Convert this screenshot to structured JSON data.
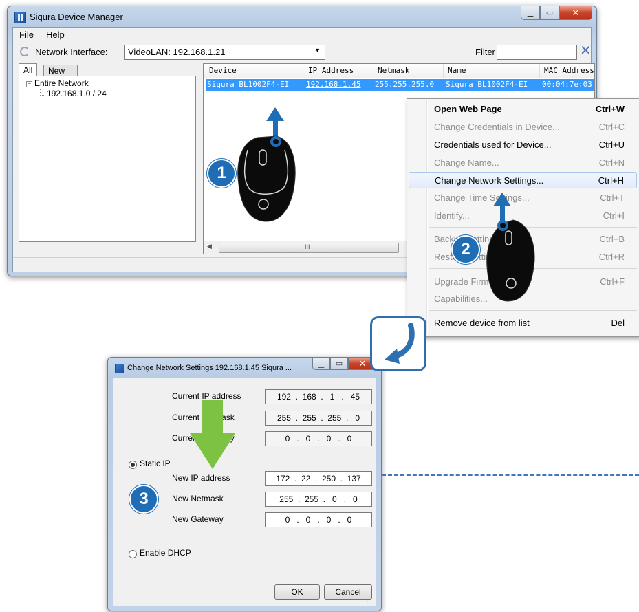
{
  "window": {
    "title": "Siqura Device Manager",
    "menu": [
      "File",
      "Help"
    ],
    "network_interface_label": "Network Interface:",
    "network_interface_value": "VideoLAN: 192.168.1.21",
    "filter_label": "Filter",
    "filter_value": "",
    "tabs": [
      "All",
      "New"
    ],
    "tree_root": "Entire Network",
    "tree_child": "192.168.1.0 / 24",
    "columns": [
      "Device",
      "IP Address",
      "Netmask",
      "Name",
      "MAC Address"
    ],
    "row": {
      "device": "Siqura BL1002F4-EI",
      "ip": "192.168.1.45",
      "netmask": "255.255.255.0",
      "name": "Siqura BL1002F4-EI",
      "mac": "00:04:7e:03"
    },
    "scroll_grip": "III"
  },
  "context_menu": [
    {
      "label": "Open Web Page",
      "shortcut": "Ctrl+W",
      "state": "bold"
    },
    {
      "label": "Change Credentials in Device...",
      "shortcut": "Ctrl+C",
      "state": "disabled"
    },
    {
      "label": "Credentials used for Device...",
      "shortcut": "Ctrl+U",
      "state": "normal"
    },
    {
      "label": "Change Name...",
      "shortcut": "Ctrl+N",
      "state": "disabled"
    },
    {
      "label": "Change Network Settings...",
      "shortcut": "Ctrl+H",
      "state": "highlighted"
    },
    {
      "label": "Change Time Settings...",
      "shortcut": "Ctrl+T",
      "state": "disabled"
    },
    {
      "label": "Identify...",
      "shortcut": "Ctrl+I",
      "state": "disabled"
    },
    {
      "label": "Backup Settings...",
      "shortcut": "Ctrl+B",
      "state": "disabled"
    },
    {
      "label": "Restore Settings...",
      "shortcut": "Ctrl+R",
      "state": "disabled"
    },
    {
      "label": "Upgrade Firmware...",
      "shortcut": "Ctrl+F",
      "state": "disabled"
    },
    {
      "label": "Capabilities...",
      "shortcut": "",
      "state": "disabled"
    },
    {
      "label": "Remove device from list",
      "shortcut": "Del",
      "state": "normal"
    }
  ],
  "dialog": {
    "title": "Change Network Settings 192.168.1.45 Siqura ...",
    "current_ip_label": "Current IP address",
    "current_ip": "192  .  168  .   1   .   45",
    "current_netmask_label": "Current Netmask",
    "current_netmask": "255  .  255  .  255  .   0",
    "current_gateway_label": "Current Gateway",
    "current_gateway": "0   .   0   .   0   .   0",
    "static_ip_label": "Static IP",
    "new_ip_label": "New IP address",
    "new_ip": "172  .  22  .  250  .  137",
    "new_netmask_label": "New Netmask",
    "new_netmask": "255  .  255  .   0   .   0",
    "new_gateway_label": "New Gateway",
    "new_gateway": "0   .   0   .   0   .   0",
    "dhcp_label": "Enable DHCP",
    "ok_label": "OK",
    "cancel_label": "Cancel"
  },
  "steps": [
    "1",
    "2",
    "3"
  ],
  "colors": {
    "selection": "#3399ff",
    "step_badge": "#1f6db4",
    "green_arrow": "#7dc242",
    "dashed_line": "#3f78b8"
  }
}
